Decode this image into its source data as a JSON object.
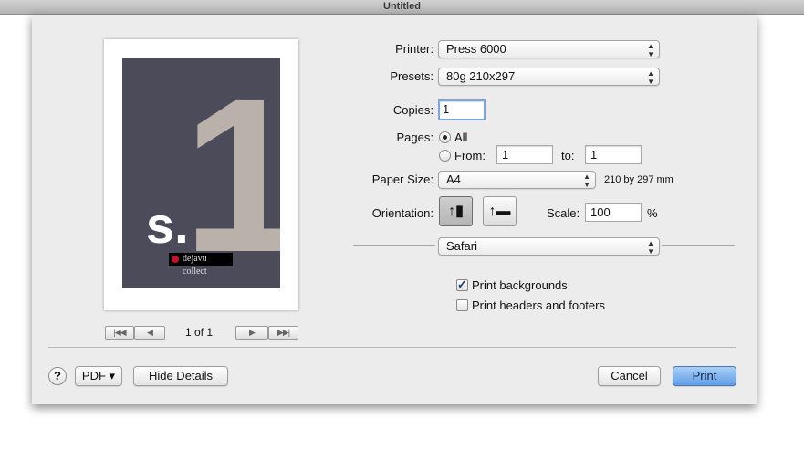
{
  "window": {
    "title": "Untitled"
  },
  "preview": {
    "poster_numeral": "1",
    "poster_letter": "s.",
    "poster_logo_text": "dejavu collect",
    "page_counter": "1 of 1",
    "pager": {
      "first": "|◀◀",
      "prev": "◀",
      "next": "▶",
      "last": "▶▶|"
    }
  },
  "form": {
    "printer_label": "Printer:",
    "printer_value": "Press 6000",
    "presets_label": "Presets:",
    "presets_value": "80g 210x297",
    "copies_label": "Copies:",
    "copies_value": "1",
    "pages_label": "Pages:",
    "pages_all_label": "All",
    "pages_from_label": "From:",
    "pages_from_value": "1",
    "pages_to_label": "to:",
    "pages_to_value": "1",
    "paper_size_label": "Paper Size:",
    "paper_size_value": "A4",
    "paper_size_dims": "210 by 297 mm",
    "orientation_label": "Orientation:",
    "scale_label": "Scale:",
    "scale_value": "100",
    "scale_unit": "%",
    "section_value": "Safari",
    "print_backgrounds_label": "Print backgrounds",
    "print_backgrounds_checked": true,
    "print_headers_label": "Print headers and footers",
    "print_headers_checked": false
  },
  "footer": {
    "help_label": "?",
    "pdf_label": "PDF ▾",
    "hide_details_label": "Hide Details",
    "cancel_label": "Cancel",
    "print_label": "Print"
  },
  "colors": {
    "accent": "#5f9ee8",
    "poster_bg": "#4c4b5a"
  },
  "icons": [
    "portrait-orientation-icon",
    "landscape-orientation-icon",
    "popup-arrows-icon",
    "checkmark-icon"
  ]
}
